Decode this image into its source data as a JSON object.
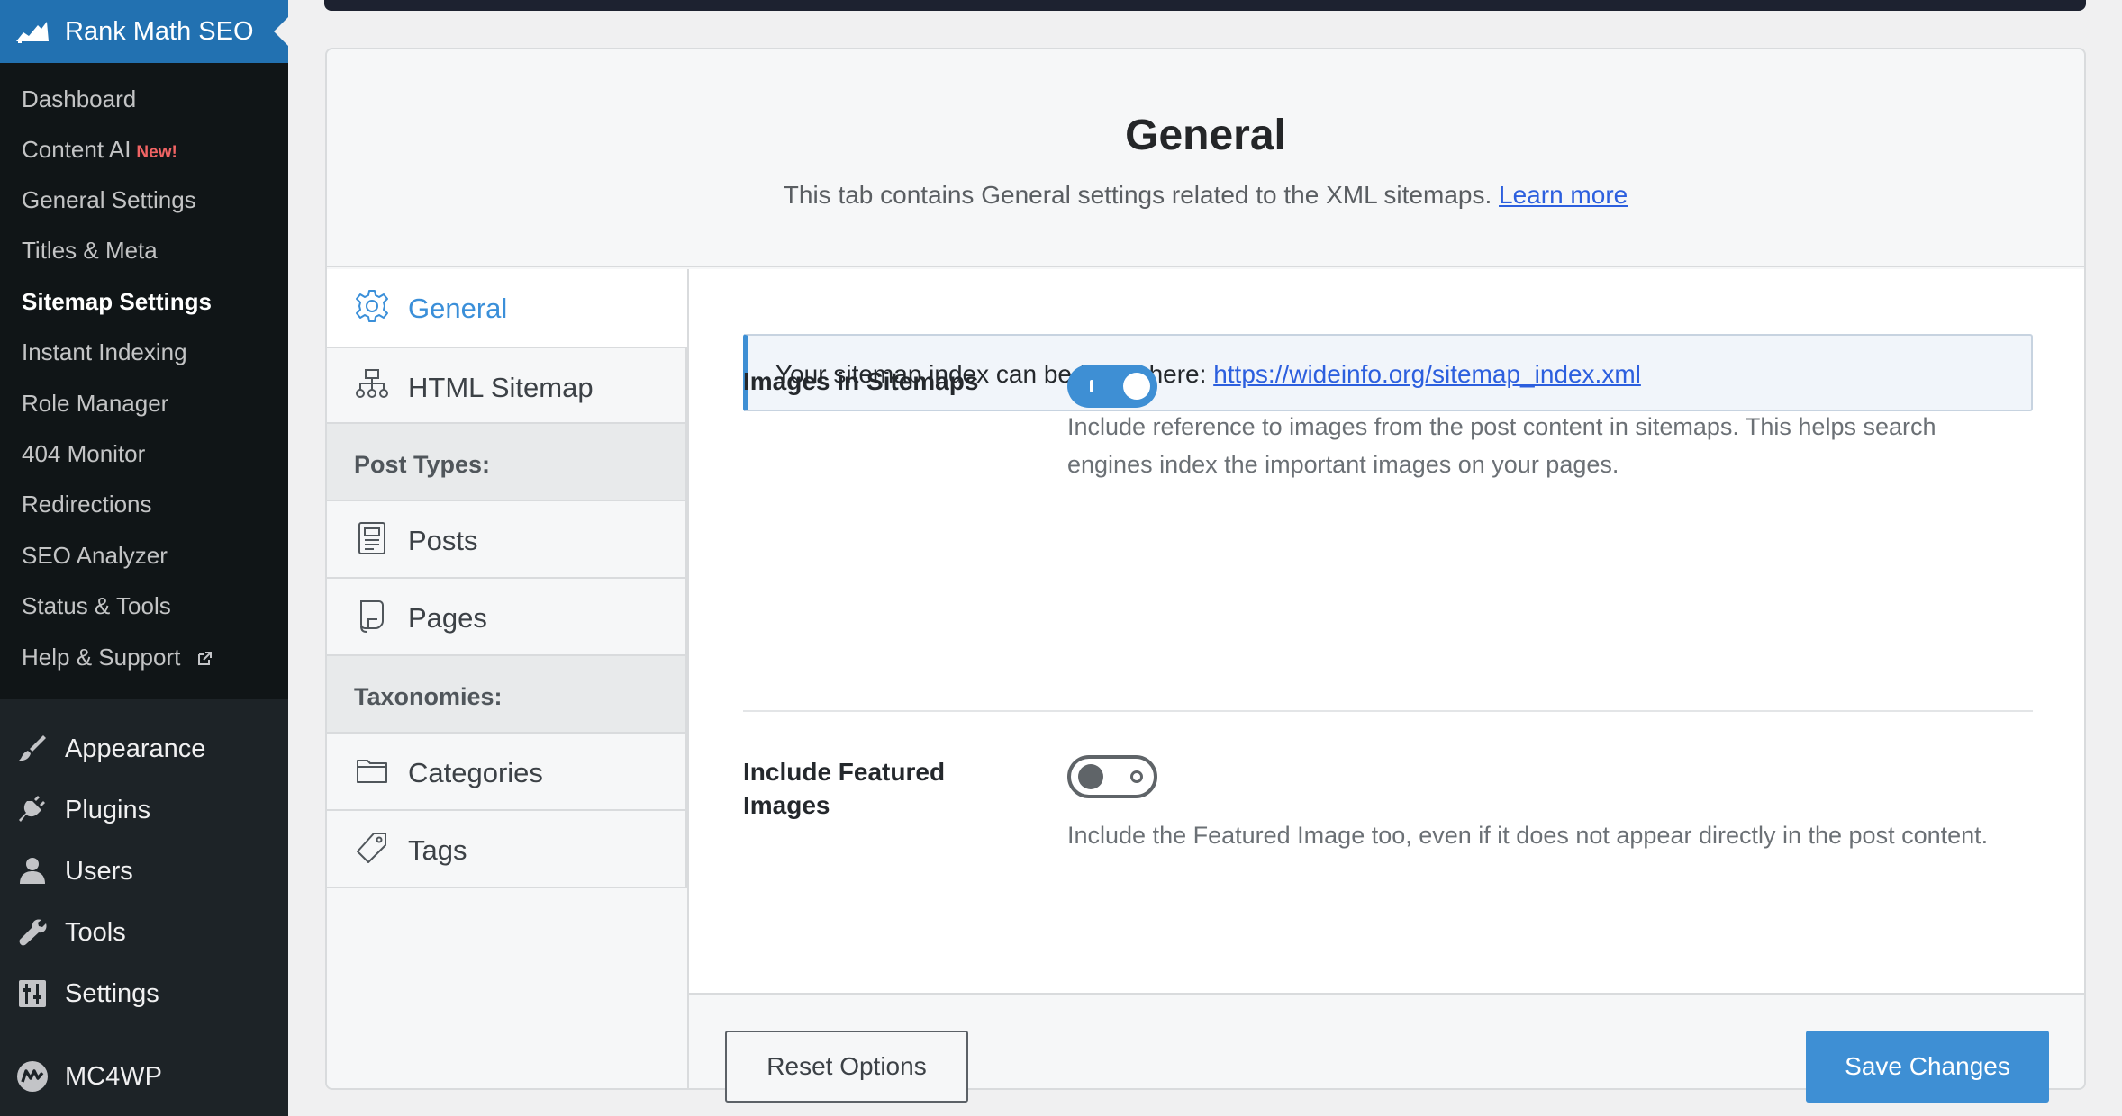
{
  "sidebar": {
    "plugin_title": "Rank Math SEO",
    "submenu": [
      {
        "label": "Dashboard"
      },
      {
        "label": "Content AI",
        "badge": "New!"
      },
      {
        "label": "General Settings"
      },
      {
        "label": "Titles & Meta"
      },
      {
        "label": "Sitemap Settings",
        "active": true
      },
      {
        "label": "Instant Indexing"
      },
      {
        "label": "Role Manager"
      },
      {
        "label": "404 Monitor"
      },
      {
        "label": "Redirections"
      },
      {
        "label": "SEO Analyzer"
      },
      {
        "label": "Status & Tools"
      },
      {
        "label": "Help & Support",
        "icon": "external-link-icon"
      }
    ],
    "menu": [
      {
        "label": "Appearance",
        "icon": "paintbrush-icon"
      },
      {
        "label": "Plugins",
        "icon": "plug-icon"
      },
      {
        "label": "Users",
        "icon": "user-icon"
      },
      {
        "label": "Tools",
        "icon": "wrench-icon"
      },
      {
        "label": "Settings",
        "icon": "sliders-icon"
      },
      {
        "label": "MC4WP",
        "icon": "mc4wp-logo-icon"
      }
    ]
  },
  "header": {
    "title": "General",
    "description": "This tab contains General settings related to the XML sitemaps.",
    "learn_more": "Learn more"
  },
  "tabs": [
    {
      "label": "General",
      "icon": "gear-icon",
      "active": true
    },
    {
      "label": "HTML Sitemap",
      "icon": "sitemap-icon"
    },
    {
      "label": "Post Types:",
      "section": true
    },
    {
      "label": "Posts",
      "icon": "document-icon"
    },
    {
      "label": "Pages",
      "icon": "page-icon"
    },
    {
      "label": "Taxonomies:",
      "section": true
    },
    {
      "label": "Categories",
      "icon": "folder-icon"
    },
    {
      "label": "Tags",
      "icon": "tag-icon"
    }
  ],
  "notice": {
    "text": "Your sitemap index can be found here:",
    "link": "https://wideinfo.org/sitemap_index.xml"
  },
  "fields": [
    {
      "label": "Images in Sitemaps",
      "enabled": true,
      "description": "Include reference to images from the post content in sitemaps. This helps search engines index the important images on your pages."
    },
    {
      "label": "Include Featured Images",
      "enabled": false,
      "description": "Include the Featured Image too, even if it does not appear directly in the post content."
    }
  ],
  "footer": {
    "reset_label": "Reset Options",
    "save_label": "Save Changes"
  },
  "colors": {
    "accent": "#3e8fd4",
    "link": "#2c5fde",
    "sidebar_bg": "#1d2327",
    "plugin_head_bg": "#2271b1"
  }
}
